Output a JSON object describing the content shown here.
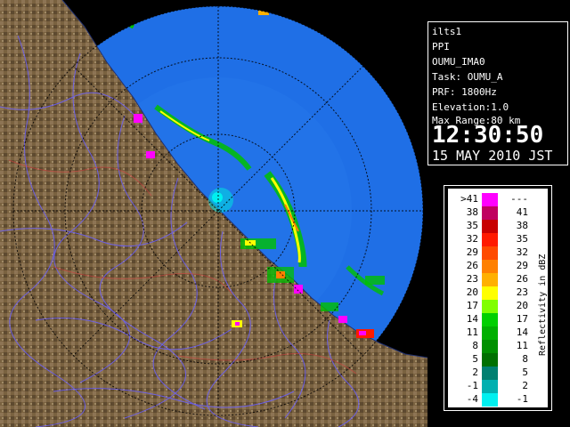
{
  "info": {
    "site": "ilts1",
    "scan": "PPI",
    "product": "OUMU_IMA0",
    "task": "Task: OUMU_A",
    "prf": "PRF: 1800Hz",
    "elevation": "Elevation:1.0",
    "max_range": "Max Range:80 km",
    "time": "12:30:50",
    "date": "15 MAY 2010 JST"
  },
  "legend": {
    "title": "Reflectivity in dBZ",
    "bins": [
      {
        "lo": ">41",
        "hi": "---",
        "color": "#ff00ff"
      },
      {
        "lo": "38",
        "hi": "41",
        "color": "#c00060"
      },
      {
        "lo": "35",
        "hi": "38",
        "color": "#c80000"
      },
      {
        "lo": "32",
        "hi": "35",
        "color": "#ff1a00"
      },
      {
        "lo": "29",
        "hi": "32",
        "color": "#ff4a00"
      },
      {
        "lo": "26",
        "hi": "29",
        "color": "#ff8000"
      },
      {
        "lo": "23",
        "hi": "26",
        "color": "#ffb000"
      },
      {
        "lo": "20",
        "hi": "23",
        "color": "#ffff00"
      },
      {
        "lo": "17",
        "hi": "20",
        "color": "#80ff00"
      },
      {
        "lo": "14",
        "hi": "17",
        "color": "#00d000"
      },
      {
        "lo": "11",
        "hi": "14",
        "color": "#00b000"
      },
      {
        "lo": "8",
        "hi": "11",
        "color": "#009000"
      },
      {
        "lo": "5",
        "hi": "8",
        "color": "#007000"
      },
      {
        "lo": "2",
        "hi": "5",
        "color": "#008070"
      },
      {
        "lo": "-1",
        "hi": "2",
        "color": "#00b0b0"
      },
      {
        "lo": "-4",
        "hi": "-1",
        "color": "#00f0f0"
      }
    ]
  },
  "colors": {
    "sea": "#2a78e8",
    "sea_out": "#1550d8",
    "land": "#7a6240",
    "rivers": "#6a60ff",
    "range_rings": "#000000"
  }
}
